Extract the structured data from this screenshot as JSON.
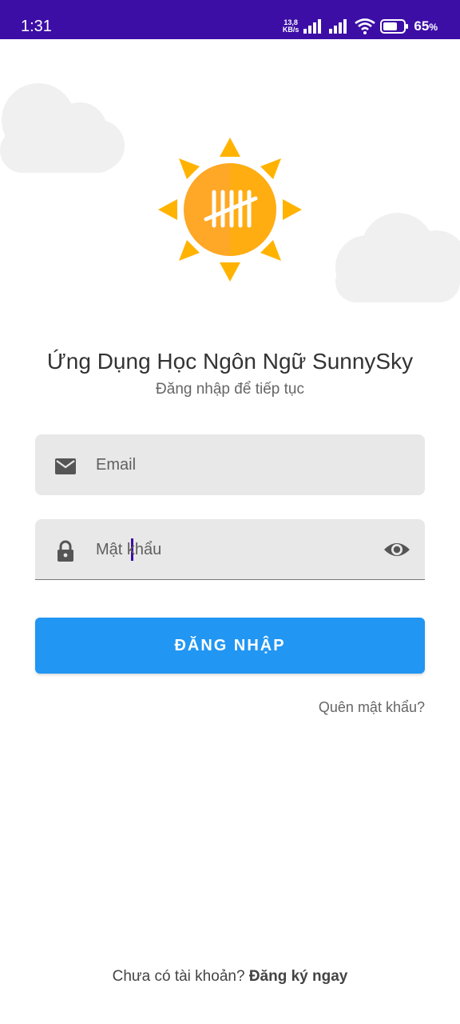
{
  "status_bar": {
    "time": "1:31",
    "net_speed_value": "13,8",
    "net_speed_unit": "KB/s",
    "battery_percent": "65",
    "battery_percent_sign": "%",
    "background_color": "#3d0ea6"
  },
  "logo": {
    "icon": "sun-logo-icon",
    "sun_color": "#ffa726",
    "ray_color": "#ffb300"
  },
  "header": {
    "title": "Ứng Dụng Học Ngôn Ngữ SunnySky",
    "subtitle": "Đăng nhập để tiếp tục"
  },
  "form": {
    "email": {
      "placeholder": "Email",
      "value": "",
      "icon": "email-icon"
    },
    "password": {
      "placeholder": "Mật khẩu",
      "value": "",
      "icon": "lock-icon",
      "toggle_icon": "eye-icon"
    },
    "login_label": "ĐĂNG NHẬP",
    "forgot_label": "Quên mật khẩu?"
  },
  "footer": {
    "prompt": "Chưa có tài khoản? ",
    "signup_label": "Đăng ký ngay"
  },
  "colors": {
    "accent": "#2196f3",
    "field_bg": "#e8e8e8",
    "cloud": "#f0f0f0"
  }
}
